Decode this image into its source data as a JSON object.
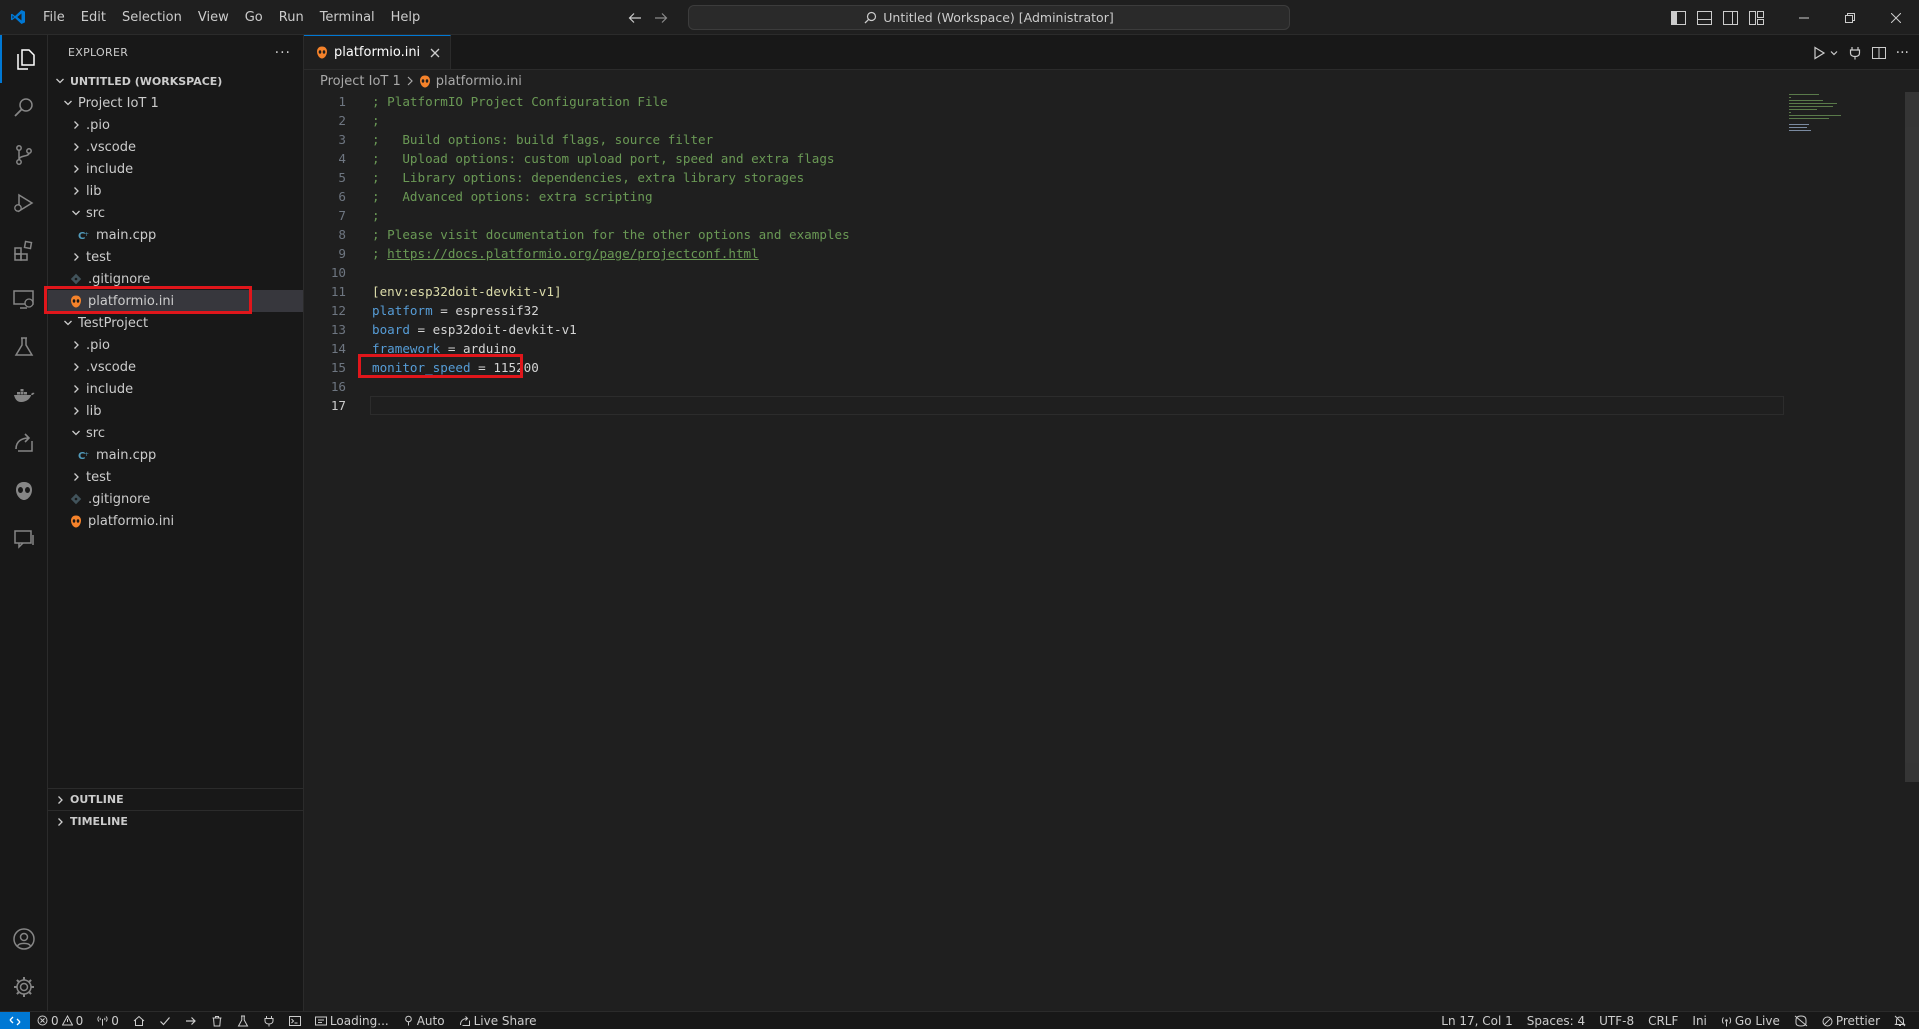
{
  "menu": [
    "File",
    "Edit",
    "Selection",
    "View",
    "Go",
    "Run",
    "Terminal",
    "Help"
  ],
  "command_center": "Untitled (Workspace) [Administrator]",
  "explorer": {
    "title": "EXPLORER",
    "workspace": "UNTITLED (WORKSPACE)",
    "tree": [
      {
        "label": "Project IoT 1",
        "depth": 1,
        "kind": "folder-open",
        "selected": false
      },
      {
        "label": ".pio",
        "depth": 2,
        "kind": "folder",
        "selected": false
      },
      {
        "label": ".vscode",
        "depth": 2,
        "kind": "folder",
        "selected": false
      },
      {
        "label": "include",
        "depth": 2,
        "kind": "folder",
        "selected": false
      },
      {
        "label": "lib",
        "depth": 2,
        "kind": "folder",
        "selected": false
      },
      {
        "label": "src",
        "depth": 2,
        "kind": "folder-open",
        "selected": false
      },
      {
        "label": "main.cpp",
        "depth": 3,
        "kind": "cpp",
        "selected": false
      },
      {
        "label": "test",
        "depth": 2,
        "kind": "folder",
        "selected": false
      },
      {
        "label": ".gitignore",
        "depth": 2,
        "kind": "git",
        "selected": false
      },
      {
        "label": "platformio.ini",
        "depth": 2,
        "kind": "pio",
        "selected": true
      },
      {
        "label": "TestProject",
        "depth": 1,
        "kind": "folder-open",
        "selected": false
      },
      {
        "label": ".pio",
        "depth": 2,
        "kind": "folder",
        "selected": false
      },
      {
        "label": ".vscode",
        "depth": 2,
        "kind": "folder",
        "selected": false
      },
      {
        "label": "include",
        "depth": 2,
        "kind": "folder",
        "selected": false
      },
      {
        "label": "lib",
        "depth": 2,
        "kind": "folder",
        "selected": false
      },
      {
        "label": "src",
        "depth": 2,
        "kind": "folder-open",
        "selected": false
      },
      {
        "label": "main.cpp",
        "depth": 3,
        "kind": "cpp",
        "selected": false
      },
      {
        "label": "test",
        "depth": 2,
        "kind": "folder",
        "selected": false
      },
      {
        "label": ".gitignore",
        "depth": 2,
        "kind": "git",
        "selected": false
      },
      {
        "label": "platformio.ini",
        "depth": 2,
        "kind": "pio",
        "selected": false
      }
    ],
    "outline": "OUTLINE",
    "timeline": "TIMELINE"
  },
  "editor": {
    "tab_label": "platformio.ini",
    "breadcrumb_folder": "Project IoT 1",
    "breadcrumb_file": "platformio.ini",
    "current_line": 17,
    "lines": [
      "; PlatformIO Project Configuration File",
      ";",
      ";   Build options: build flags, source filter",
      ";   Upload options: custom upload port, speed and extra flags",
      ";   Library options: dependencies, extra library storages",
      ";   Advanced options: extra scripting",
      ";",
      "; Please visit documentation for the other options and examples",
      "; https://docs.platformio.org/page/projectconf.html",
      "",
      "[env:esp32doit-devkit-v1]",
      "platform = espressif32",
      "board = esp32doit-devkit-v1",
      "framework = arduino",
      "monitor_speed = 115200",
      "",
      ""
    ]
  },
  "status": {
    "errors": "0",
    "warnings": "0",
    "ports": "0",
    "loading": "Loading...",
    "auto": "Auto",
    "live_share": "Live Share",
    "position": "Ln 17, Col 1",
    "spaces": "Spaces: 4",
    "encoding": "UTF-8",
    "eol": "CRLF",
    "language": "Ini",
    "go_live": "Go Live",
    "prettier": "Prettier"
  },
  "colors": {
    "accent": "#0078d4",
    "highlight_box": "#e0161b",
    "comment": "#6a9955",
    "key": "#569cd6"
  }
}
